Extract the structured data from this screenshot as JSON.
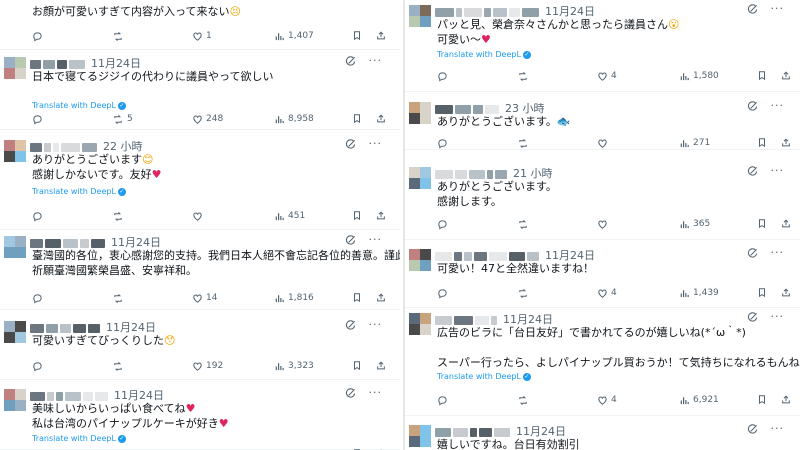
{
  "left_column": [
    {
      "text": [
        "お顔が可愛いすぎて内容が入って来ない😣"
      ],
      "time": "",
      "translate": false,
      "stats": {
        "replies": "",
        "retweets": "",
        "likes": "1",
        "views": "1,407"
      }
    },
    {
      "text": [
        "日本で寝てるジジイの代わりに議員やって欲しい"
      ],
      "time": "11月24日",
      "translate": true,
      "stats": {
        "replies": "",
        "retweets": "5",
        "likes": "248",
        "views": "8,958"
      }
    },
    {
      "text": [
        "ありがとうございます😊",
        "感謝しかないです。友好♥"
      ],
      "time": "22 小時",
      "translate": true,
      "stats": {
        "replies": "",
        "retweets": "",
        "likes": "",
        "views": "451"
      }
    },
    {
      "text": [
        "臺灣國的各位，衷心感謝您的支持。我們日本人絕不會忘記各位的善意。謹此",
        "祈願臺灣國繁榮昌盛、安寧祥和。"
      ],
      "time": "11月24日",
      "translate": false,
      "stats": {
        "replies": "",
        "retweets": "",
        "likes": "14",
        "views": "1,816"
      }
    },
    {
      "text": [
        "可愛いすぎてびっくりした😯"
      ],
      "time": "11月24日",
      "translate": false,
      "stats": {
        "replies": "",
        "retweets": "",
        "likes": "192",
        "views": "3,323"
      }
    },
    {
      "text": [
        "美味しいからいっぱい食べてね♥",
        "私は台湾のパイナップルケーキが好き♥"
      ],
      "time": "11月24日",
      "translate": true,
      "stats": {
        "replies": "",
        "retweets": "",
        "likes": "",
        "views": ""
      }
    }
  ],
  "right_column": [
    {
      "text": [
        "パッと見、榮倉奈々さんかと思ったら議員さん😮",
        "可愛い～♥"
      ],
      "time": "11月24日",
      "translate": true,
      "stats": {
        "replies": "",
        "retweets": "",
        "likes": "4",
        "views": "1,580"
      }
    },
    {
      "text": [
        "ありがとうございます。🐟"
      ],
      "time": "23 小時",
      "translate": false,
      "stats": {
        "replies": "",
        "retweets": "",
        "likes": "",
        "views": "271"
      }
    },
    {
      "text": [
        "ありがとうございます。",
        "感謝します。"
      ],
      "time": "21 小時",
      "translate": false,
      "stats": {
        "replies": "",
        "retweets": "",
        "likes": "",
        "views": "365"
      }
    },
    {
      "text": [
        "可愛い！47と全然違いますね！"
      ],
      "time": "11月24日",
      "translate": false,
      "stats": {
        "replies": "",
        "retweets": "",
        "likes": "4",
        "views": "1,439"
      }
    },
    {
      "text": [
        "広告のビラに「台日友好」で書かれてるのが嬉しいね(*´ω｀*)",
        "",
        "スーパー行ったら、よしパイナップル買おうか！て気持ちになれるもんね🍀"
      ],
      "time": "11月24日",
      "translate": true,
      "stats": {
        "replies": "",
        "retweets": "",
        "likes": "4",
        "views": "6,921"
      }
    },
    {
      "text": [
        "嬉しいですね。台日有効割引"
      ],
      "time": "11月24日",
      "translate": false,
      "stats": {
        "replies": "",
        "retweets": "",
        "likes": "",
        "views": ""
      }
    }
  ],
  "labels": {
    "translate": "Translate with DeepL",
    "badge": "✓",
    "more": "···"
  },
  "colors": {
    "link": "#1d9bf0",
    "muted": "#536471",
    "heart": "#e0245e"
  }
}
